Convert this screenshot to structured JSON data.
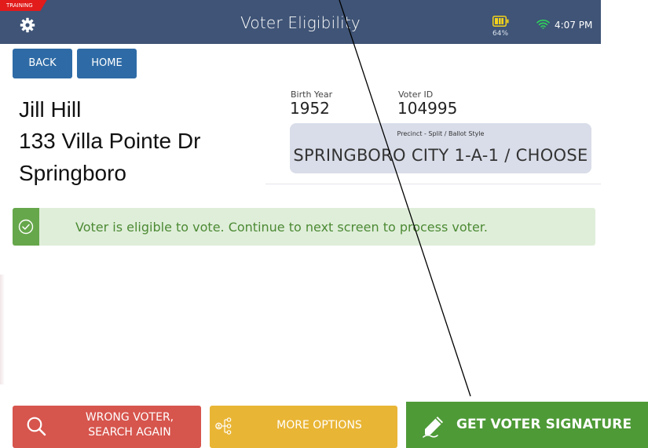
{
  "header": {
    "training_badge": "TRAINING",
    "title": "Voter Eligibility",
    "battery_percent": "64%",
    "time": "4:07 PM",
    "icons": [
      "gear-icon",
      "battery-icon",
      "wifi-icon"
    ]
  },
  "nav": {
    "back_label": "BACK",
    "home_label": "HOME"
  },
  "voter": {
    "name": "Jill Hill",
    "address": "133 Villa Pointe Dr",
    "city": "Springboro",
    "birth_year_label": "Birth Year",
    "birth_year": "1952",
    "voter_id_label": "Voter ID",
    "voter_id": "104995",
    "precinct_label": "Precinct - Split / Ballot Style",
    "precinct": "SPRINGBORO CITY 1-A-1 / CHOOSE"
  },
  "status": {
    "message": "Voter is eligible to vote. Continue to next screen to process voter.",
    "icon": "check-circle-icon"
  },
  "actions": {
    "wrong_voter_line1": "WRONG VOTER,",
    "wrong_voter_line2": "SEARCH AGAIN",
    "more_options": "MORE OPTIONS",
    "get_signature": "GET VOTER SIGNATURE"
  },
  "colors": {
    "header_bg": "#3f5476",
    "nav_button": "#2e6ba6",
    "training_red": "#e21b1b",
    "eligible_green": "#66a74b",
    "banner_bg": "#dfeed9",
    "wrong_voter_red": "#d6554d",
    "more_options_yellow": "#e9b535",
    "signature_green": "#4e9a37",
    "battery_yellow": "#f3d21b",
    "wifi_green": "#2fd35a"
  }
}
